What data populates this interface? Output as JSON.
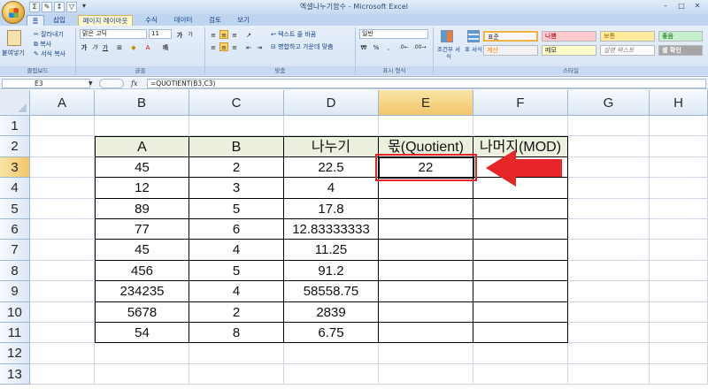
{
  "window": {
    "title": "엑셀나누기함수 - Microsoft Excel",
    "qat_icons": [
      "sum-icon",
      "format-painter-icon",
      "sort-icon",
      "filter-icon",
      "dropdown-icon"
    ]
  },
  "tabs": [
    "홈",
    "삽입",
    "페이지 레이아웃",
    "수식",
    "데이터",
    "검토",
    "보기"
  ],
  "ribbon": {
    "clipboard": {
      "paste": "붙여넣기",
      "cut": "잘라내기",
      "copy": "복사",
      "format_painter": "서식 복사",
      "label": "클립보드"
    },
    "font": {
      "name": "맑은 고딕",
      "size": "11",
      "grow": "가",
      "shrink": "가",
      "bold": "가",
      "italic": "가",
      "underline": "가",
      "label": "글꼴"
    },
    "alignment": {
      "wrap_text": "텍스트 줄 바꿈",
      "merge_center": "병합하고 가운데 맞춤",
      "label": "맞춤"
    },
    "number": {
      "format": "일반",
      "currency": "₩",
      "percent": "%",
      "comma": ",",
      "label": "표시 형식"
    },
    "styles": {
      "conditional": "조건부 서식",
      "table": "표 서식",
      "cells": [
        {
          "label": "표준",
          "bg": "#ffffff",
          "fg": "#222222"
        },
        {
          "label": "나쁨",
          "bg": "#ffc7ce",
          "fg": "#9c0006"
        },
        {
          "label": "보통",
          "bg": "#ffeb9c",
          "fg": "#9c6500"
        },
        {
          "label": "좋음",
          "bg": "#c6efce",
          "fg": "#006100"
        },
        {
          "label": "계산",
          "bg": "#f2f2f2",
          "fg": "#fa7d00"
        },
        {
          "label": "메모",
          "bg": "#ffffcc",
          "fg": "#222222"
        },
        {
          "label": "설명 텍스트",
          "bg": "#ffffff",
          "fg": "#7f7f7f"
        },
        {
          "label": "셀 확인",
          "bg": "#a5a5a5",
          "fg": "#ffffff"
        }
      ],
      "label": "스타일"
    }
  },
  "formula_bar": {
    "cell_ref": "E3",
    "fx": "fx",
    "formula": "=QUOTIENT(B3,C3)"
  },
  "sheet": {
    "columns": [
      "A",
      "B",
      "C",
      "D",
      "E",
      "F",
      "G",
      "H"
    ],
    "rows": [
      "1",
      "2",
      "3",
      "4",
      "5",
      "6",
      "7",
      "8",
      "9",
      "10",
      "11",
      "12",
      "13"
    ],
    "active_col": "E",
    "active_row": "3",
    "table_header": [
      "A",
      "B",
      "나누기",
      "몫(Quotient)",
      "나머지(MOD)"
    ],
    "table_rows": [
      [
        "45",
        "2",
        "22.5",
        "22",
        ""
      ],
      [
        "12",
        "3",
        "4",
        "",
        ""
      ],
      [
        "89",
        "5",
        "17.8",
        "",
        ""
      ],
      [
        "77",
        "6",
        "12.83333333",
        "",
        ""
      ],
      [
        "45",
        "4",
        "11.25",
        "",
        ""
      ],
      [
        "456",
        "5",
        "91.2",
        "",
        ""
      ],
      [
        "234235",
        "4",
        "58558.75",
        "",
        ""
      ],
      [
        "5678",
        "2",
        "2839",
        "",
        ""
      ],
      [
        "54",
        "8",
        "6.75",
        "",
        ""
      ]
    ]
  },
  "colors": {
    "highlight_red": "#e8262a",
    "header_fill": "#ebf1de",
    "ribbon_bg": "#dbe6f4"
  }
}
